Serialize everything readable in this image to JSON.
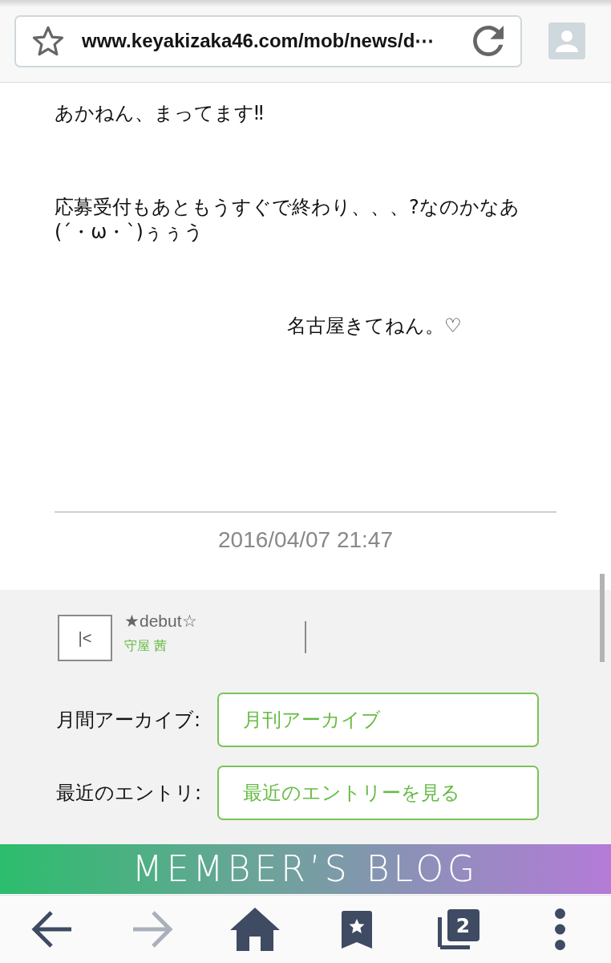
{
  "browser_bar": {
    "url": "www.keyakizaka46.com/mob/news/d⋯",
    "bookmarked": false
  },
  "post": {
    "paragraphs": [
      {
        "kind": "plain",
        "text": "あかねん、まってます‼"
      },
      {
        "kind": "plain",
        "text": "応募受付もあともうすぐで終わり、、、?なのかなあ\n(´・ω・`)ぅぅう"
      },
      {
        "kind": "indented",
        "text": "名古屋きてねん。♡"
      }
    ],
    "date": "2016/04/07 21:47"
  },
  "pager": {
    "first_symbol": "|<",
    "title": "★debut☆",
    "author": "守屋 茜"
  },
  "links": [
    {
      "label": "月間アーカイブ:",
      "button": "月刊アーカイブ"
    },
    {
      "label": "最近のエントリ:",
      "button": "最近のエントリーを見る"
    }
  ],
  "banner": {
    "title": "MEMBER’S BLOG"
  },
  "toolbar": [
    {
      "kind": "back",
      "disabled": false
    },
    {
      "kind": "forward",
      "disabled": true
    },
    {
      "kind": "home",
      "disabled": false
    },
    {
      "kind": "bookmarks",
      "disabled": false
    },
    {
      "kind": "tabs",
      "count": "2",
      "disabled": false
    },
    {
      "kind": "menu",
      "disabled": false
    }
  ]
}
